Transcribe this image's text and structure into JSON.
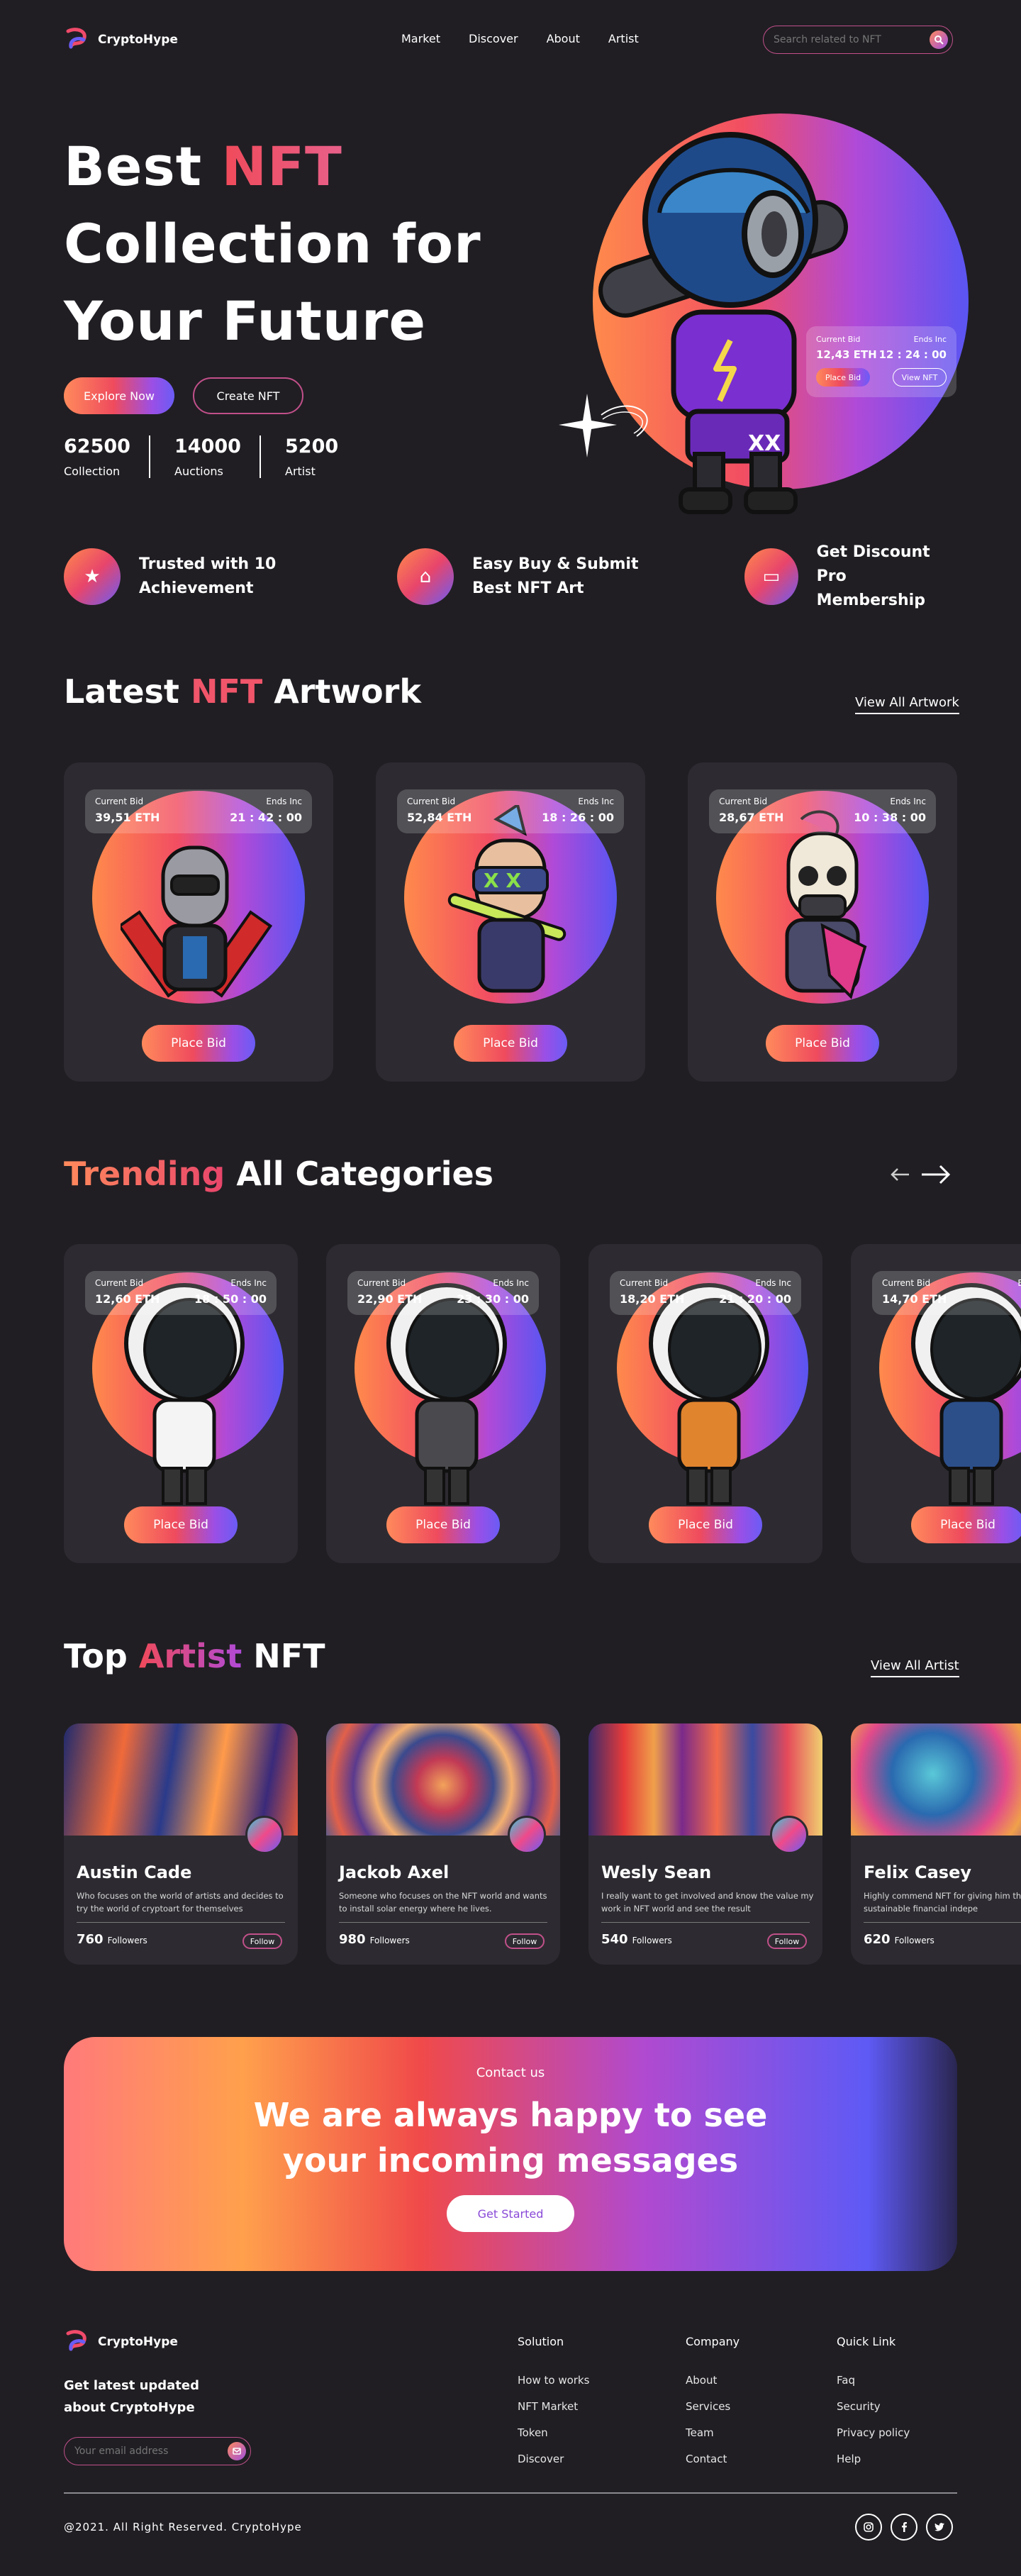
{
  "brand": {
    "name": "CryptoHype"
  },
  "nav": {
    "items": [
      "Market",
      "Discover",
      "About",
      "Artist"
    ]
  },
  "search": {
    "placeholder": "Search related to NFT"
  },
  "hero": {
    "title_1": "Best ",
    "title_nft": "NFT",
    "title_2": "Collection for",
    "title_3": "Your Future",
    "explore_label": "Explore Now",
    "create_label": "Create NFT",
    "stats": [
      {
        "value": "62500",
        "label": "Collection"
      },
      {
        "value": "14000",
        "label": "Auctions"
      },
      {
        "value": "5200",
        "label": "Artist"
      }
    ],
    "bid_card": {
      "current_label": "Current Bid",
      "current_value": "12,43 ETH",
      "ends_label": "Ends Inc",
      "ends_value": "12 : 24 : 00",
      "place_label": "Place Bid",
      "view_label": "View NFT"
    }
  },
  "features": [
    {
      "line1": "Trusted with 10",
      "line2": "Achievement",
      "icon": "trophy-icon"
    },
    {
      "line1": "Easy Buy & Submit",
      "line2": "Best NFT Art",
      "icon": "bag-icon"
    },
    {
      "line1": "Get Discount Pro",
      "line2": "Membership",
      "icon": "card-icon"
    }
  ],
  "latest": {
    "title_1": "Latest ",
    "title_nft": "NFT",
    "title_2": " Artwork",
    "view_all": "View All Artwork",
    "cards": [
      {
        "current_label": "Current Bid",
        "current_value": "39,51 ETH",
        "ends_label": "Ends Inc",
        "ends_value": "21 : 42 : 00",
        "button": "Place Bid"
      },
      {
        "current_label": "Current Bid",
        "current_value": "52,84 ETH",
        "ends_label": "Ends Inc",
        "ends_value": "18 : 26 : 00",
        "button": "Place Bid"
      },
      {
        "current_label": "Current Bid",
        "current_value": "28,67 ETH",
        "ends_label": "Ends Inc",
        "ends_value": "10 : 38 : 00",
        "button": "Place Bid"
      }
    ]
  },
  "trending": {
    "title_1": "Trending",
    "title_2": " All Categories",
    "cards": [
      {
        "current_label": "Current Bid",
        "current_value": "12,60 ETH",
        "ends_label": "Ends Inc",
        "ends_value": "18 : 50 : 00",
        "button": "Place Bid",
        "shirt": "#f4f4f4"
      },
      {
        "current_label": "Current Bid",
        "current_value": "22,90 ETH",
        "ends_label": "Ends Inc",
        "ends_value": "23 : 30 : 00",
        "button": "Place Bid",
        "shirt": "#4a4a4e"
      },
      {
        "current_label": "Current Bid",
        "current_value": "18,20 ETH",
        "ends_label": "Ends Inc",
        "ends_value": "21 : 20 : 00",
        "button": "Place Bid",
        "shirt": "#e0842e"
      },
      {
        "current_label": "Current Bid",
        "current_value": "14,70 ETH",
        "ends_label": "Ends Inc",
        "ends_value": "",
        "button": "Place Bid",
        "shirt": "#2c4f8a"
      }
    ]
  },
  "artists": {
    "title_1": "Top ",
    "title_artist": "Artist",
    "title_2": " NFT",
    "view_all": "View All Artist",
    "followers_label": "Followers",
    "follow_label": "Follow",
    "cards": [
      {
        "name": "Austin Cade",
        "desc": "Who focuses on the world of artists and decides to try the world of cryptoart for themselves",
        "followers": "760",
        "bg": "linear-gradient(100deg,#1e2a6e 0%,#f06a3a 25%,#2a3a8a 45%,#ff9a4a 65%,#3a2a7a 85%,#e55a3a 100%)"
      },
      {
        "name": "Jackob Axel",
        "desc": "Someone who focuses on the NFT world and wants to install solar energy where he lives.",
        "followers": "980",
        "bg": "radial-gradient(circle at 50% 55%,#f2a25a 0%,#c23a55 20%,#3a4a8e 38%,#f4b070 52%,#5a3a8e 68%,#e2604a 84%,#3a5a9a 100%)"
      },
      {
        "name": "Wesly Sean",
        "desc": "I really want to get involved and know the value my work in NFT world and see the result",
        "followers": "540",
        "bg": "linear-gradient(90deg,#3a2a6a 0%,#e43a3a 15%,#f0a04a 28%,#7a2a8a 40%,#f26a4a 55%,#3a4aa0 70%,#e54a5a 85%,#f0d070 100%)"
      },
      {
        "name": "Felix Casey",
        "desc": "Highly commend NFT for giving him the achieve sustainable financial indepe",
        "followers": "620",
        "bg": "radial-gradient(circle at 35% 45%,#5ac8d8 0%,#2a6ab0 25%,#e24a8a 45%,#f0a04a 60%,#6a3aa0 80%,#5ad0c0 100%)"
      }
    ]
  },
  "contact": {
    "label": "Contact us",
    "heading_1": "We are always happy to see",
    "heading_2": "your incoming messages",
    "button": "Get Started"
  },
  "footer": {
    "tagline_1": "Get latest updated",
    "tagline_2": "about CryptoHype",
    "email_placeholder": "Your email address",
    "columns": [
      {
        "title": "Solution",
        "links": [
          "How to works",
          "NFT Market",
          "Token",
          "Discover"
        ]
      },
      {
        "title": "Company",
        "links": [
          "About",
          "Services",
          "Team",
          "Contact"
        ]
      },
      {
        "title": "Quick Link",
        "links": [
          "Faq",
          "Security",
          "Privacy policy",
          "Help"
        ]
      }
    ],
    "copyright": "@2021. All Right Reserved. CryptoHype",
    "social": [
      "instagram-icon",
      "facebook-icon",
      "twitter-icon"
    ]
  }
}
